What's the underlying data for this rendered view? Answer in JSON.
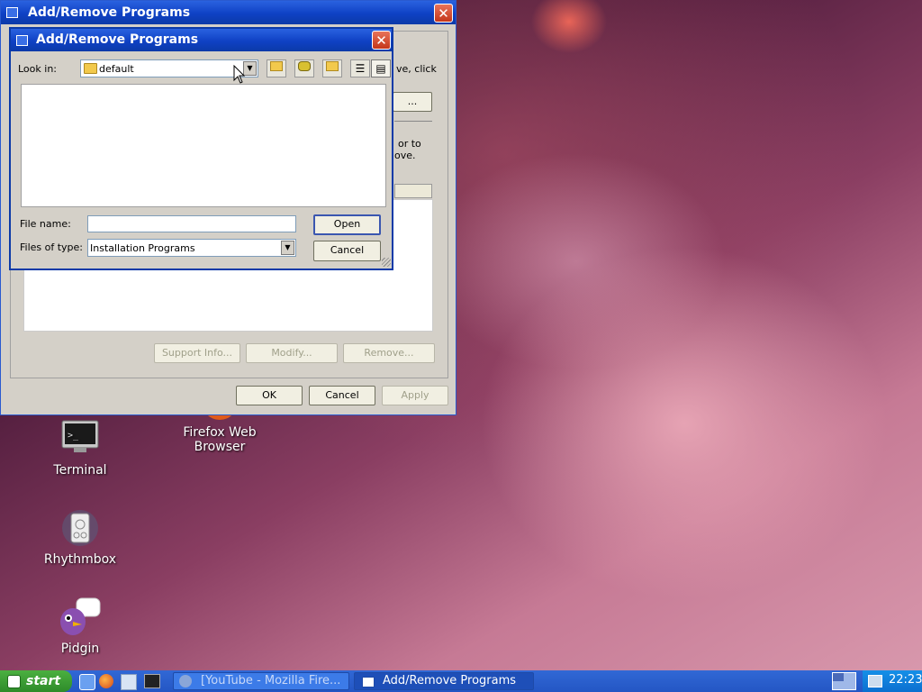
{
  "back_window": {
    "title": "Add/Remove Programs",
    "partial_text_1": "ve, click",
    "partial_button": "...",
    "partial_text_2": "or to",
    "partial_text_3": "ove.",
    "support_info_label": "Support Info...",
    "modify_label": "Modify...",
    "remove_label": "Remove...",
    "ok_label": "OK",
    "cancel_label": "Cancel",
    "apply_label": "Apply"
  },
  "file_dialog": {
    "title": "Add/Remove Programs",
    "look_in_label": "Look in:",
    "look_in_value": "default",
    "file_name_label": "File name:",
    "file_name_value": "",
    "files_of_type_label": "Files of type:",
    "files_of_type_value": "Installation Programs",
    "open_label": "Open",
    "cancel_label": "Cancel"
  },
  "desktop_icons": {
    "firefox": "Firefox Web Browser",
    "terminal": "Terminal",
    "rhythmbox": "Rhythmbox",
    "pidgin": "Pidgin"
  },
  "taskbar": {
    "start_label": "start",
    "task_1": "[YouTube - Mozilla Fire...",
    "task_2": "Add/Remove Programs",
    "clock": "22:23"
  },
  "colors": {
    "title_bar": "#0f41c4",
    "taskbar": "#2456c4",
    "start_button": "#2e8b2a",
    "dialog_face": "#d4d0c8"
  }
}
